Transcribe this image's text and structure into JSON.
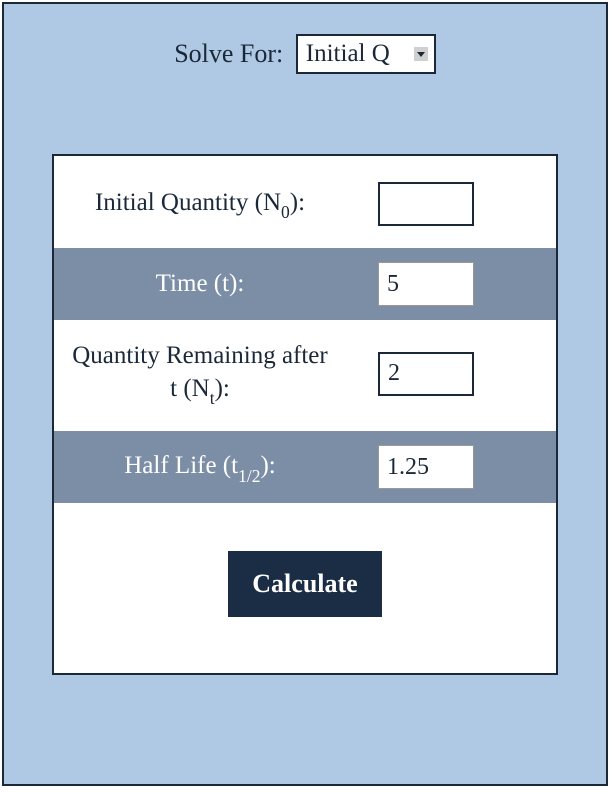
{
  "solveFor": {
    "label": "Solve For:",
    "selected": "Initial Q"
  },
  "fields": {
    "initialQuantity": {
      "labelPrefix": "Initial Quantity (N",
      "labelSub": "0",
      "labelSuffix": "):",
      "value": ""
    },
    "time": {
      "label": "Time (t):",
      "value": "5"
    },
    "quantityRemaining": {
      "labelPrefix": "Quantity Remaining after t (N",
      "labelSub": "t",
      "labelSuffix": "):",
      "value": "2"
    },
    "halfLife": {
      "labelPrefix": "Half Life (t",
      "labelSub": "1/2",
      "labelSuffix": "):",
      "value": "1.25"
    }
  },
  "button": {
    "calculate": "Calculate"
  }
}
